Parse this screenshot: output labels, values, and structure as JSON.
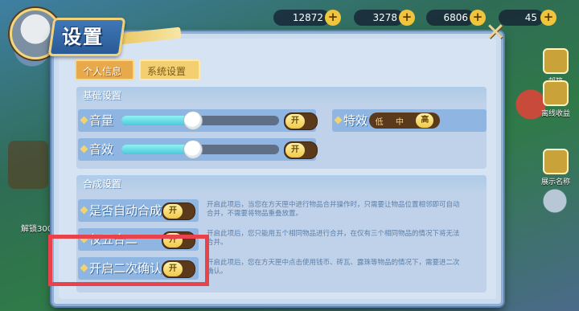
{
  "hud": {
    "resource_1": "12872",
    "resource_2": "3278",
    "resource_3": "6806",
    "resource_4": "45",
    "plus": "+"
  },
  "side": {
    "right_buttons": [
      "邮箱",
      "离线收益",
      "展示名称"
    ],
    "left_label": "解锁300"
  },
  "dialog": {
    "title": "设置",
    "close": "✕",
    "tabs": {
      "personal": "个人信息",
      "system": "系统设置"
    },
    "basic": {
      "header": "基础设置",
      "volume_label": "音量",
      "volume_level": 0.45,
      "sfx_label": "音效",
      "sfx_level": 0.45,
      "toggle_on": "开",
      "effects_label": "特效",
      "effects_options": [
        "低",
        "中",
        "高"
      ],
      "effects_selected": "高"
    },
    "merge": {
      "header": "合成设置",
      "items": [
        {
          "label": "是否自动合成",
          "toggle": "开",
          "desc": "开启此项后，当您在方天匣中进行物品合并操作时，只需要让物品位置相邻即可自动合并，不需要将物品重叠放置。"
        },
        {
          "label": "仅五合二",
          "toggle": "开",
          "desc": "开启此项后，您只能用五个相同物品进行合并，在仅有三个相同物品的情况下将无法合并。"
        },
        {
          "label": "开启二次确认",
          "toggle": "开",
          "desc": "开启此项后，您在方天匣中点击使用钱币、砖瓦、露珠等物品的情况下，需要进二次确认。"
        }
      ]
    }
  },
  "colors": {
    "highlight": "#e8424a",
    "accent": "#f0c94a",
    "panel": "#d6e3f2"
  }
}
